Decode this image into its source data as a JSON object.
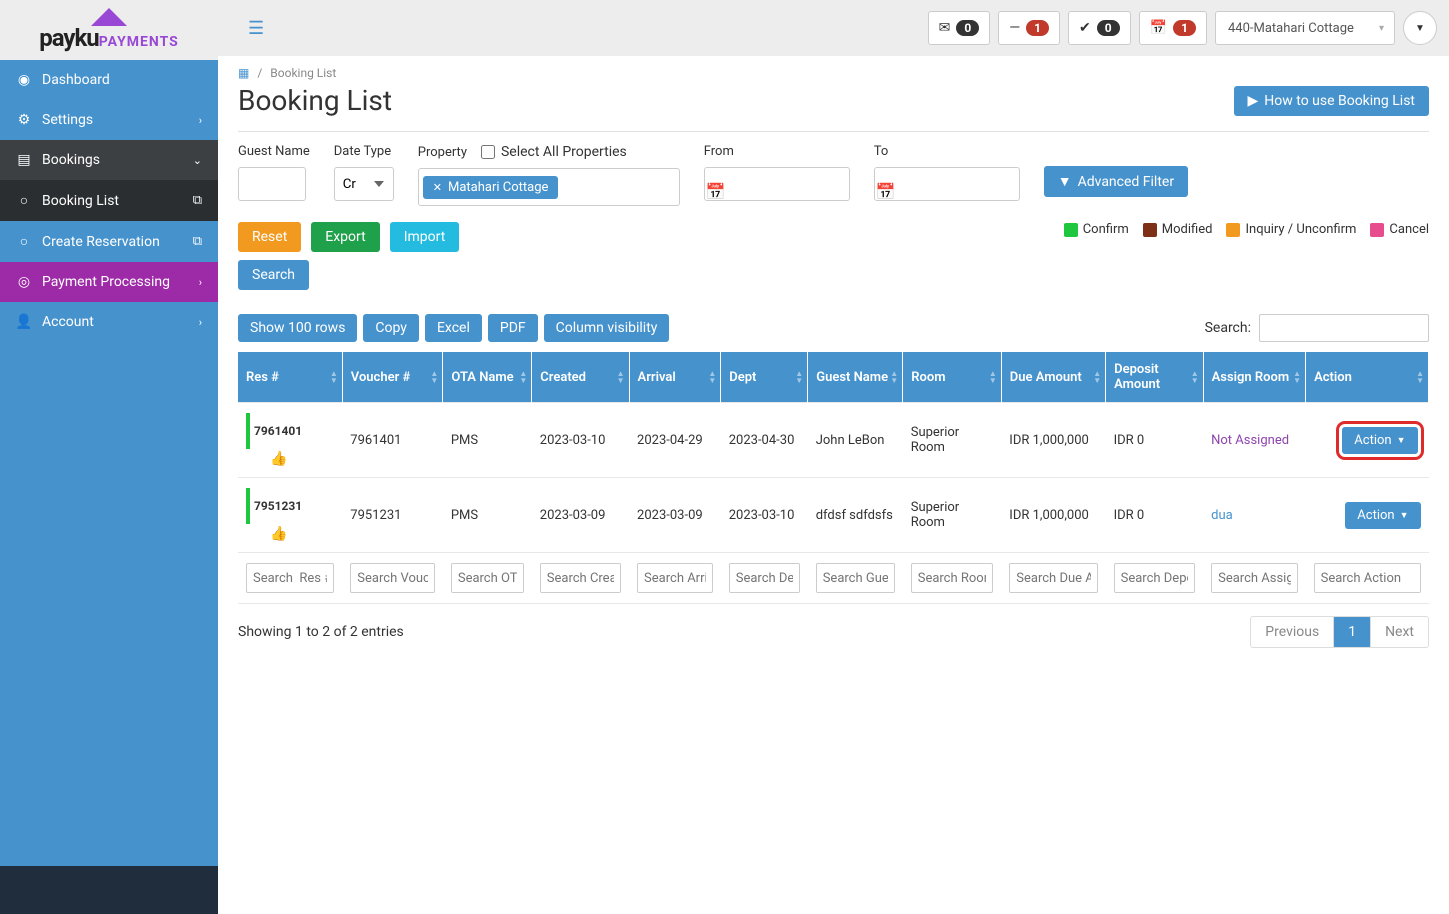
{
  "brand": {
    "main": "payku",
    "sub": "PAYMENTS"
  },
  "topbar": {
    "stats": [
      {
        "icon": "envelope",
        "value": "0",
        "badge": "dark"
      },
      {
        "icon": "minus",
        "value": "1",
        "badge": "red"
      },
      {
        "icon": "check",
        "value": "0",
        "badge": "dark"
      },
      {
        "icon": "calendar",
        "value": "1",
        "badge": "red"
      }
    ],
    "property": "440-Matahari Cottage"
  },
  "sidebar": {
    "items": [
      {
        "icon": "dashboard",
        "label": "Dashboard"
      },
      {
        "icon": "gear",
        "label": "Settings",
        "chev": true
      },
      {
        "icon": "list",
        "label": "Bookings",
        "chev_down": true,
        "variant": "dark"
      },
      {
        "icon": "circle",
        "label": "Booking List",
        "ext": true,
        "variant": "darker"
      },
      {
        "icon": "circle",
        "label": "Create Reservation",
        "ext": true
      },
      {
        "icon": "target",
        "label": "Payment Processing",
        "chev": true,
        "variant": "purple"
      },
      {
        "icon": "user",
        "label": "Account",
        "chev": true
      }
    ]
  },
  "breadcrumb": {
    "current": "Booking List"
  },
  "page": {
    "title": "Booking List",
    "help": "How to use Booking List"
  },
  "filters": {
    "guest_name": "Guest Name",
    "date_type": "Date Type",
    "date_type_value": "Cr",
    "property": "Property",
    "select_all": "Select All Properties",
    "property_tag": "Matahari Cottage",
    "from": "From",
    "to": "To",
    "advanced": "Advanced Filter"
  },
  "buttons": {
    "reset": "Reset",
    "export": "Export",
    "import": "Import",
    "search": "Search"
  },
  "legend": [
    {
      "color": "#1fc73e",
      "label": "Confirm"
    },
    {
      "color": "#7d3015",
      "label": "Modified"
    },
    {
      "color": "#f29a1f",
      "label": "Inquiry / Unconfirm"
    },
    {
      "color": "#e74c8c",
      "label": "Cancel"
    }
  ],
  "table_controls": {
    "show": "Show 100 rows",
    "copy": "Copy",
    "excel": "Excel",
    "pdf": "PDF",
    "colvis": "Column visibility",
    "search_label": "Search:"
  },
  "columns": [
    "Res #",
    "Voucher #",
    "OTA Name",
    "Created",
    "Arrival",
    "Dept",
    "Guest Name",
    "Room",
    "Due Amount",
    "Deposit Amount",
    "Assign Room",
    "Action"
  ],
  "rows": [
    {
      "res": "7961401",
      "voucher": "7961401",
      "ota": "PMS",
      "created": "2023-03-10",
      "arrival": "2023-04-29",
      "dept": "2023-04-30",
      "guest": "John LeBon",
      "room": "Superior Room",
      "due": "IDR 1,000,000",
      "deposit": "IDR 0",
      "assign": "Not Assigned",
      "assign_class": "",
      "highlight": true,
      "action": "Action"
    },
    {
      "res": "7951231",
      "voucher": "7951231",
      "ota": "PMS",
      "created": "2023-03-09",
      "arrival": "2023-03-09",
      "dept": "2023-03-10",
      "guest": "dfdsf sdfdsfs",
      "room": "Superior Room",
      "due": "IDR 1,000,000",
      "deposit": "IDR 0",
      "assign": "dua",
      "assign_class": "blue",
      "highlight": false,
      "action": "Action"
    }
  ],
  "col_search": [
    "Search  Res #",
    "Search Voucher #",
    "Search OTA Name",
    "Search Created",
    "Search Arrival",
    "Search Dept",
    "Search Guest Name",
    "Search Room",
    "Search Due Amount",
    "Search Deposit Amount",
    "Search Assign Room",
    "Search Action"
  ],
  "footer": {
    "info": "Showing 1 to 2 of 2 entries",
    "prev": "Previous",
    "page": "1",
    "next": "Next"
  }
}
